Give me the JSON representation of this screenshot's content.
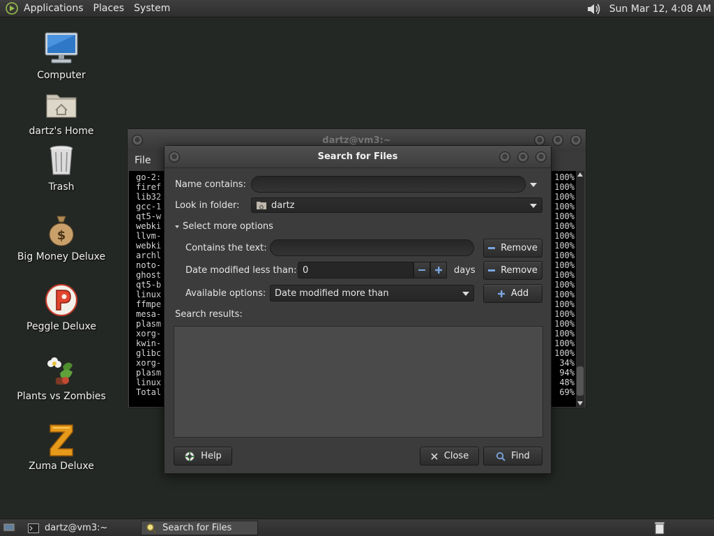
{
  "top_panel": {
    "menus": [
      "Applications",
      "Places",
      "System"
    ],
    "clock": "Sun Mar 12,  4:08 AM"
  },
  "desktop": {
    "icons": [
      {
        "label": "Computer",
        "icon": "computer-icon"
      },
      {
        "label": "dartz's Home",
        "icon": "home-folder-icon"
      },
      {
        "label": "Trash",
        "icon": "trash-icon"
      },
      {
        "label": "Big Money Deluxe",
        "icon": "money-bag-icon"
      },
      {
        "label": "Peggle Deluxe",
        "icon": "peggle-icon"
      },
      {
        "label": "Plants vs Zombies",
        "icon": "plants-vs-zombies-icon"
      },
      {
        "label": "Zuma Deluxe",
        "icon": "zuma-icon"
      }
    ]
  },
  "terminal": {
    "title": "dartz@vm3:~",
    "menu_file": "File",
    "left_lines": [
      "go-2:",
      "firef",
      "lib32",
      "gcc-1",
      "qt5-w",
      "webki",
      "llvm-",
      "webki",
      "archl",
      "noto-",
      "ghost",
      "qt5-b",
      "linux",
      "ffmpe",
      "mesa-",
      "plasm",
      "xorg-",
      "kwin-",
      "glibc",
      "xorg-",
      "plasm",
      "linux",
      "Total"
    ],
    "right_lines": [
      "100%",
      "100%",
      "100%",
      "100%",
      "100%",
      "100%",
      "100%",
      "100%",
      "100%",
      "100%",
      "100%",
      "100%",
      "100%",
      "100%",
      "100%",
      "100%",
      "100%",
      "100%",
      "100%",
      "34%",
      "94%",
      "48%",
      "69%"
    ]
  },
  "dialog": {
    "title": "Search for Files",
    "name_contains_label": "Name contains:",
    "name_contains_value": "",
    "look_in_label": "Look in folder:",
    "look_in_value": "dartz",
    "more_options_label": "Select more options",
    "contains_text_label": "Contains the text:",
    "contains_text_value": "",
    "date_less_label": "Date modified less than:",
    "date_less_value": "0",
    "days_label": "days",
    "available_label": "Available options:",
    "available_value": "Date modified more than",
    "remove_label": "Remove",
    "add_label": "Add",
    "results_label": "Search results:",
    "help_label": "Help",
    "close_label": "Close",
    "find_label": "Find"
  },
  "bottom_panel": {
    "tasks": [
      "dartz@vm3:~",
      "Search for Files"
    ]
  }
}
